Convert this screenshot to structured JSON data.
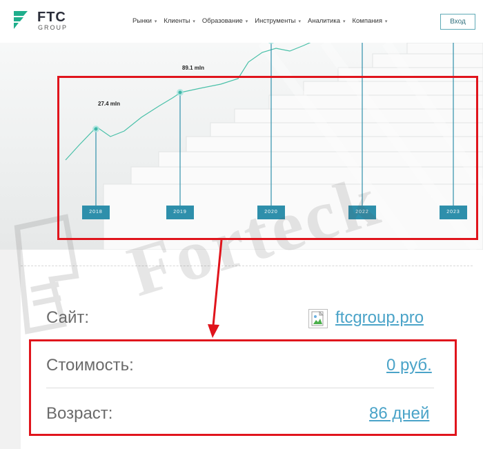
{
  "header": {
    "logo_text": "FTC",
    "logo_sub": "GROUP",
    "nav": [
      "Рынки",
      "Клиенты",
      "Образование",
      "Инструменты",
      "Аналитика",
      "Компания"
    ],
    "login_label": "Вход"
  },
  "hero": {
    "milestones": [
      "27.4 mln",
      "89.1 mln"
    ],
    "years": [
      "2018",
      "2019",
      "2020",
      "2022",
      "2023"
    ],
    "accent": "#2e8fab"
  },
  "info": {
    "site_label": "Сайт:",
    "site_value": "ftcgroup.pro",
    "cost_label": "Стоимость:",
    "cost_value": "0 руб.",
    "age_label": "Возраст:",
    "age_value": "86 дней"
  },
  "watermark": {
    "text": "Forteck"
  },
  "colors": {
    "annotation": "#e0141c",
    "link": "#4aa3c8",
    "brand": "#1fae8c"
  }
}
